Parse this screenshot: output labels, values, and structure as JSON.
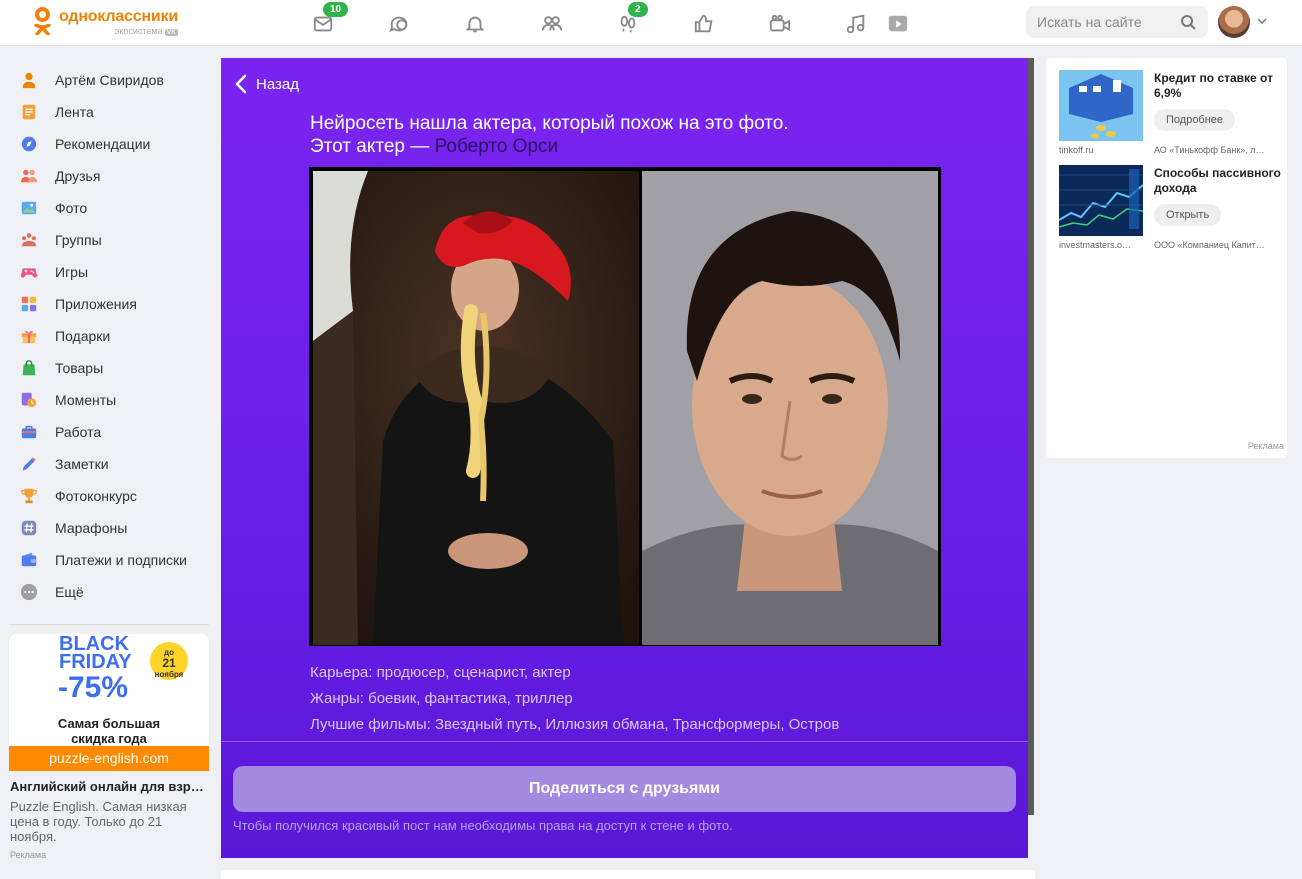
{
  "brand": {
    "name": "одноклассники",
    "sub": "экосистема",
    "vk": "VK",
    "color": "#ee8208"
  },
  "topnav": [
    {
      "name": "messages-icon",
      "badge": "10"
    },
    {
      "name": "discussions-icon",
      "badge": ""
    },
    {
      "name": "notifications-icon",
      "badge": ""
    },
    {
      "name": "friends-icon",
      "badge": ""
    },
    {
      "name": "guests-icon",
      "badge": "2"
    },
    {
      "name": "likes-icon",
      "badge": ""
    },
    {
      "name": "video-icon",
      "badge": ""
    },
    {
      "name": "music-icon",
      "badge": ""
    },
    {
      "name": "play-icon",
      "badge": ""
    }
  ],
  "search": {
    "placeholder": "Искать на сайте"
  },
  "sidebar": {
    "items": [
      {
        "label": "Артём Свиридов",
        "icon": "profile-icon"
      },
      {
        "label": "Лента",
        "icon": "feed-icon"
      },
      {
        "label": "Рекомендации",
        "icon": "compass-icon"
      },
      {
        "label": "Друзья",
        "icon": "friends-icon"
      },
      {
        "label": "Фото",
        "icon": "photo-icon"
      },
      {
        "label": "Группы",
        "icon": "groups-icon"
      },
      {
        "label": "Игры",
        "icon": "gamepad-icon"
      },
      {
        "label": "Приложения",
        "icon": "apps-icon"
      },
      {
        "label": "Подарки",
        "icon": "gift-icon"
      },
      {
        "label": "Товары",
        "icon": "shopping-bag-icon"
      },
      {
        "label": "Моменты",
        "icon": "moments-icon"
      },
      {
        "label": "Работа",
        "icon": "briefcase-icon"
      },
      {
        "label": "Заметки",
        "icon": "pencil-icon"
      },
      {
        "label": "Фотоконкурс",
        "icon": "trophy-icon"
      },
      {
        "label": "Марафоны",
        "icon": "hashtag-icon"
      },
      {
        "label": "Платежи и подписки",
        "icon": "wallet-icon"
      },
      {
        "label": "Ещё",
        "icon": "more-icon"
      }
    ]
  },
  "left_ad": {
    "line1": "BLACK",
    "line2": "FRIDAY",
    "discount": "-75%",
    "sticker_top": "до",
    "sticker_day": "21",
    "sticker_month": "ноября",
    "slogan_1": "Самая большая",
    "slogan_2": "скидка года",
    "url": "puzzle-english.com",
    "title": "Английский онлайн для взр…",
    "text": "Puzzle English. Самая низкая цена в году. Только до 21 ноября.",
    "mark": "Реклама"
  },
  "main": {
    "back": "Назад",
    "headline_1": "Нейросеть нашла актера, который похож на это фото.",
    "headline_2_prefix": "Этот актер — ",
    "actor_name": "Роберто Орси",
    "career": "Карьера: продюсер, сценарист, актер",
    "genres": "Жанры: боевик, фантастика, триллер",
    "films": "Лучшие фильмы: Звездный путь, Иллюзия обмана, Трансформеры, Остров",
    "share_button": "Поделиться с друзьями",
    "share_note": "Чтобы получился красивый пост нам необходимы права на доступ к стене и фото."
  },
  "right_ads": [
    {
      "title": "Кредит по ставке от 6,9%",
      "button": "Подробнее",
      "source": "tinkoff.ru",
      "org": "АО «Тинькофф Банк», л…"
    },
    {
      "title": "Способы пассивного дохода",
      "button": "Открыть",
      "source": "investmasters.o…",
      "org": "ООО «Компаниец Капит…"
    }
  ],
  "right_mark": "Реклама",
  "colors": {
    "panel": "#6a1fe8",
    "badge": "#2fb34a",
    "accent": "#ee8208"
  }
}
